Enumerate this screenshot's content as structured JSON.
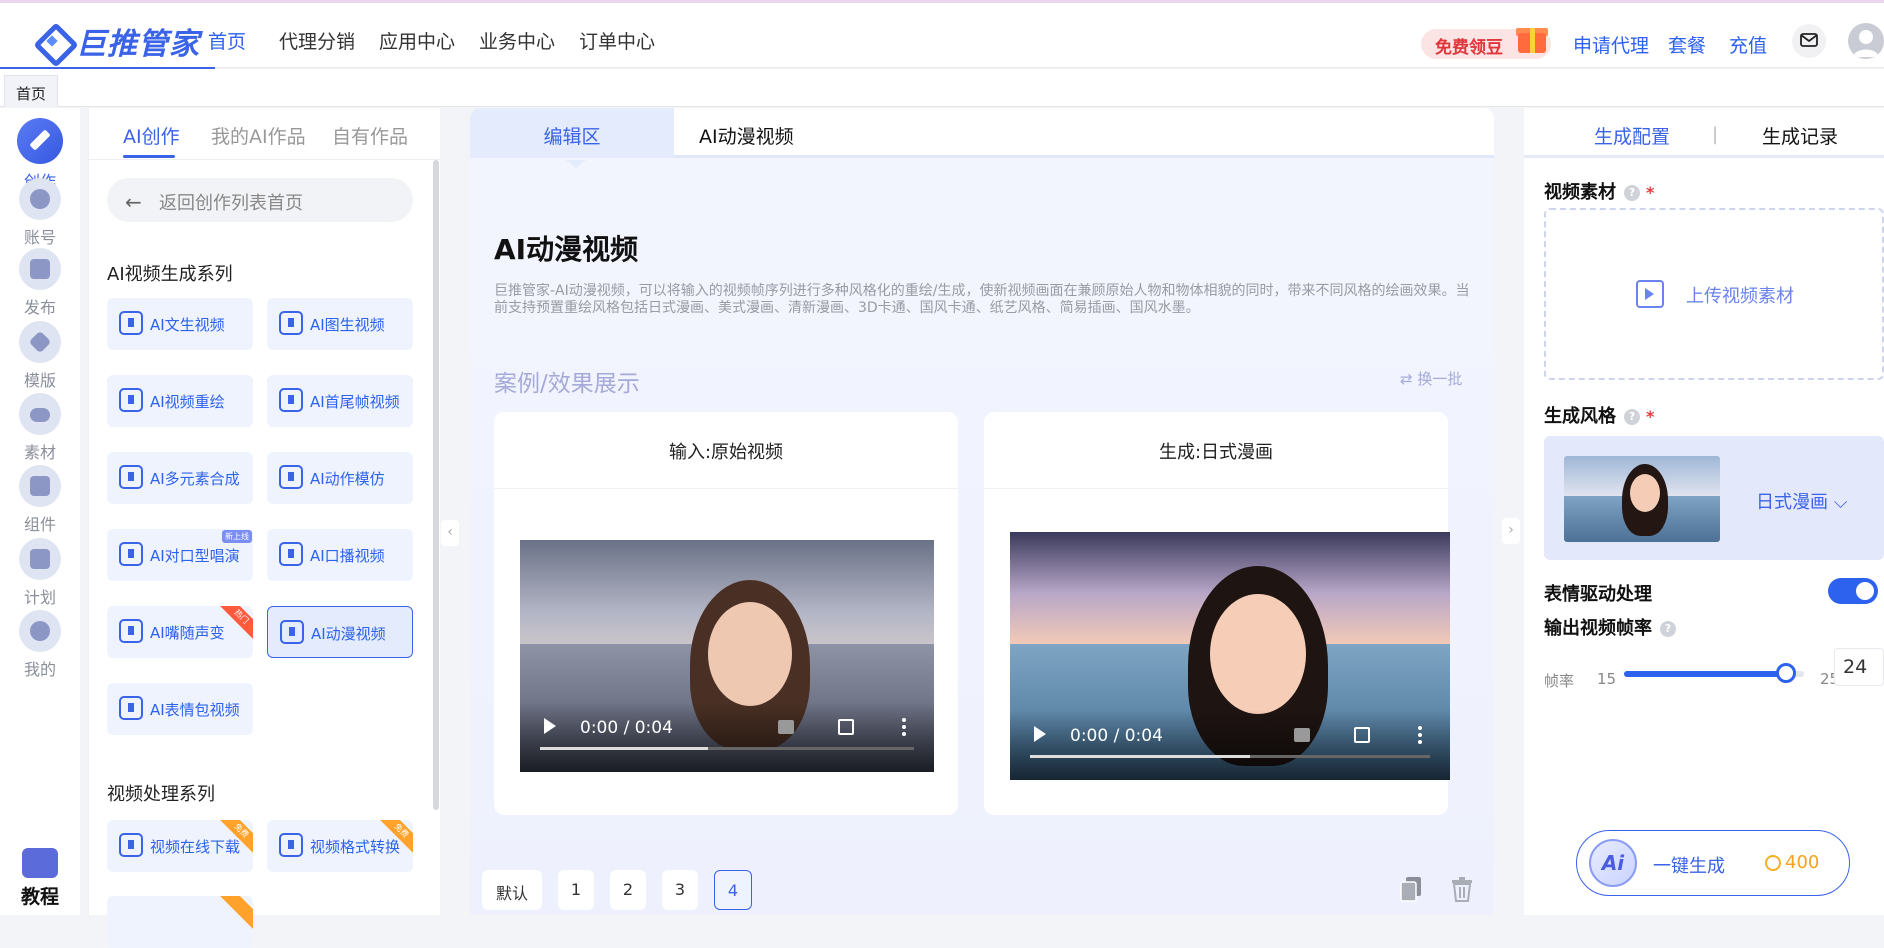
{
  "brand": {
    "name": "巨推管家"
  },
  "topnav": [
    "首页",
    "代理分销",
    "应用中心",
    "业务中心",
    "订单中心"
  ],
  "header_right": {
    "free_bean": "免费领豆",
    "apply_agent": "申请代理",
    "package": "套餐",
    "recharge": "充值"
  },
  "tabstrip": {
    "home": "首页"
  },
  "rail": {
    "items": [
      "创作",
      "账号",
      "发布",
      "模版",
      "素材",
      "组件",
      "计划",
      "我的"
    ],
    "tutorial": "教程"
  },
  "left_panel": {
    "tabs": [
      "AI创作",
      "我的AI作品",
      "自有作品"
    ],
    "back": "返回创作列表首页",
    "section1": "AI视频生成系列",
    "tools": [
      {
        "label": "AI文生视频",
        "tag": ""
      },
      {
        "label": "AI图生视频",
        "tag": ""
      },
      {
        "label": "AI视频重绘",
        "tag": ""
      },
      {
        "label": "AI首尾帧视频",
        "tag": ""
      },
      {
        "label": "AI多元素合成",
        "tag": ""
      },
      {
        "label": "AI动作模仿",
        "tag": ""
      },
      {
        "label": "AI对口型唱演",
        "tag": "新上线"
      },
      {
        "label": "AI口播视频",
        "tag": ""
      },
      {
        "label": "AI嘴随声变",
        "tag": "热门"
      },
      {
        "label": "AI动漫视频",
        "tag": ""
      },
      {
        "label": "AI表情包视频",
        "tag": ""
      }
    ],
    "section2": "视频处理系列",
    "tools2": [
      {
        "label": "视频在线下载",
        "tag": "免费"
      },
      {
        "label": "视频格式转换",
        "tag": "免费"
      }
    ]
  },
  "center": {
    "tabs": {
      "edit": "编辑区",
      "current": "AI动漫视频"
    },
    "title": "AI动漫视频",
    "description": "巨推管家-AI动漫视频，可以将输入的视频帧序列进行多种风格化的重绘/生成，使新视频画面在兼顾原始人物和物体相貌的同时，带来不同风格的绘画效果。当前支持预置重绘风格包括日式漫画、美式漫画、清新漫画、3D卡通、国风卡通、纸艺风格、简易插画、国风水墨。",
    "cases_title": "案例/效果展示",
    "refresh": "换一批",
    "cards": [
      {
        "caption": "输入:原始视频",
        "time": "0:00 / 0:04",
        "progress": 0.45
      },
      {
        "caption": "生成:日式漫画",
        "time": "0:00 / 0:04",
        "progress": 0.55
      }
    ],
    "pager": [
      "默认",
      "1",
      "2",
      "3",
      "4"
    ],
    "pager_active": "4"
  },
  "right_panel": {
    "tabs": {
      "config": "生成配置",
      "divider": "|",
      "record": "生成记录"
    },
    "video_source_label": "视频素材",
    "upload_text": "上传视频素材",
    "style_label": "生成风格",
    "style_value": "日式漫画",
    "expression_label": "表情驱动处理",
    "expression_on": true,
    "fps_label": "输出视频帧率",
    "fps_prefix": "帧率",
    "fps_min": "15",
    "fps_max": "25",
    "fps_value": "24",
    "fps_fraction": 0.9,
    "generate": "一键生成",
    "cost": "400",
    "help": "?",
    "required": "*",
    "ai_badge": "Ai"
  },
  "colors": {
    "accent": "#2d62ee",
    "danger": "#e23b3b",
    "coin": "#f5a21d"
  }
}
